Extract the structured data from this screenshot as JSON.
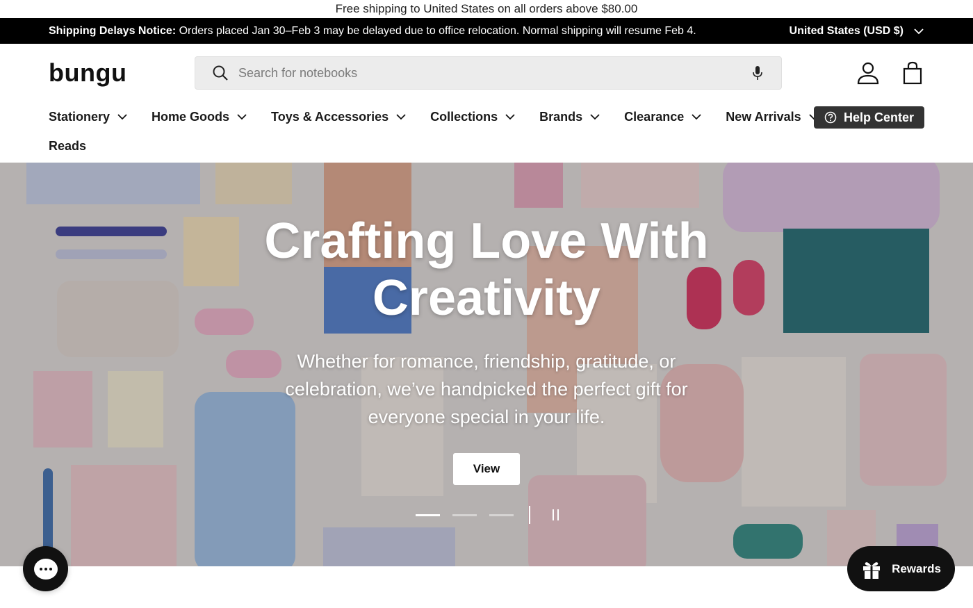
{
  "announcement": "Free shipping to United States on all orders above $80.00",
  "notice": {
    "label": "Shipping Delays Notice:",
    "text": " Orders placed Jan 30–Feb 3 may be delayed due to office relocation. Normal shipping will resume Feb 4.",
    "region": "United States (USD $)"
  },
  "header": {
    "logo": "bungu",
    "search_placeholder": "Search for notebooks"
  },
  "nav": {
    "items": [
      "Stationery",
      "Home Goods",
      "Toys & Accessories",
      "Collections",
      "Brands",
      "Clearance",
      "New Arrivals"
    ],
    "row2": "Reads",
    "help": "Help Center"
  },
  "hero": {
    "title_line1": "Crafting Love With",
    "title_line2": "Creativity",
    "subtitle": "Whether for romance, friendship, gratitude, or celebration, we’ve handpicked the perfect gift for everyone special in your life.",
    "button": "View",
    "slide_count": 3,
    "active_slide": 1
  },
  "widgets": {
    "rewards": "Rewards"
  },
  "colors": {
    "notice_bg": "#000000",
    "help_bg": "#333333",
    "search_bg": "#ececec"
  },
  "icons": [
    "search-icon",
    "microphone-icon",
    "user-icon",
    "bag-icon",
    "chevron-down-icon",
    "help-icon",
    "pause-icon",
    "chat-icon",
    "gift-icon"
  ]
}
